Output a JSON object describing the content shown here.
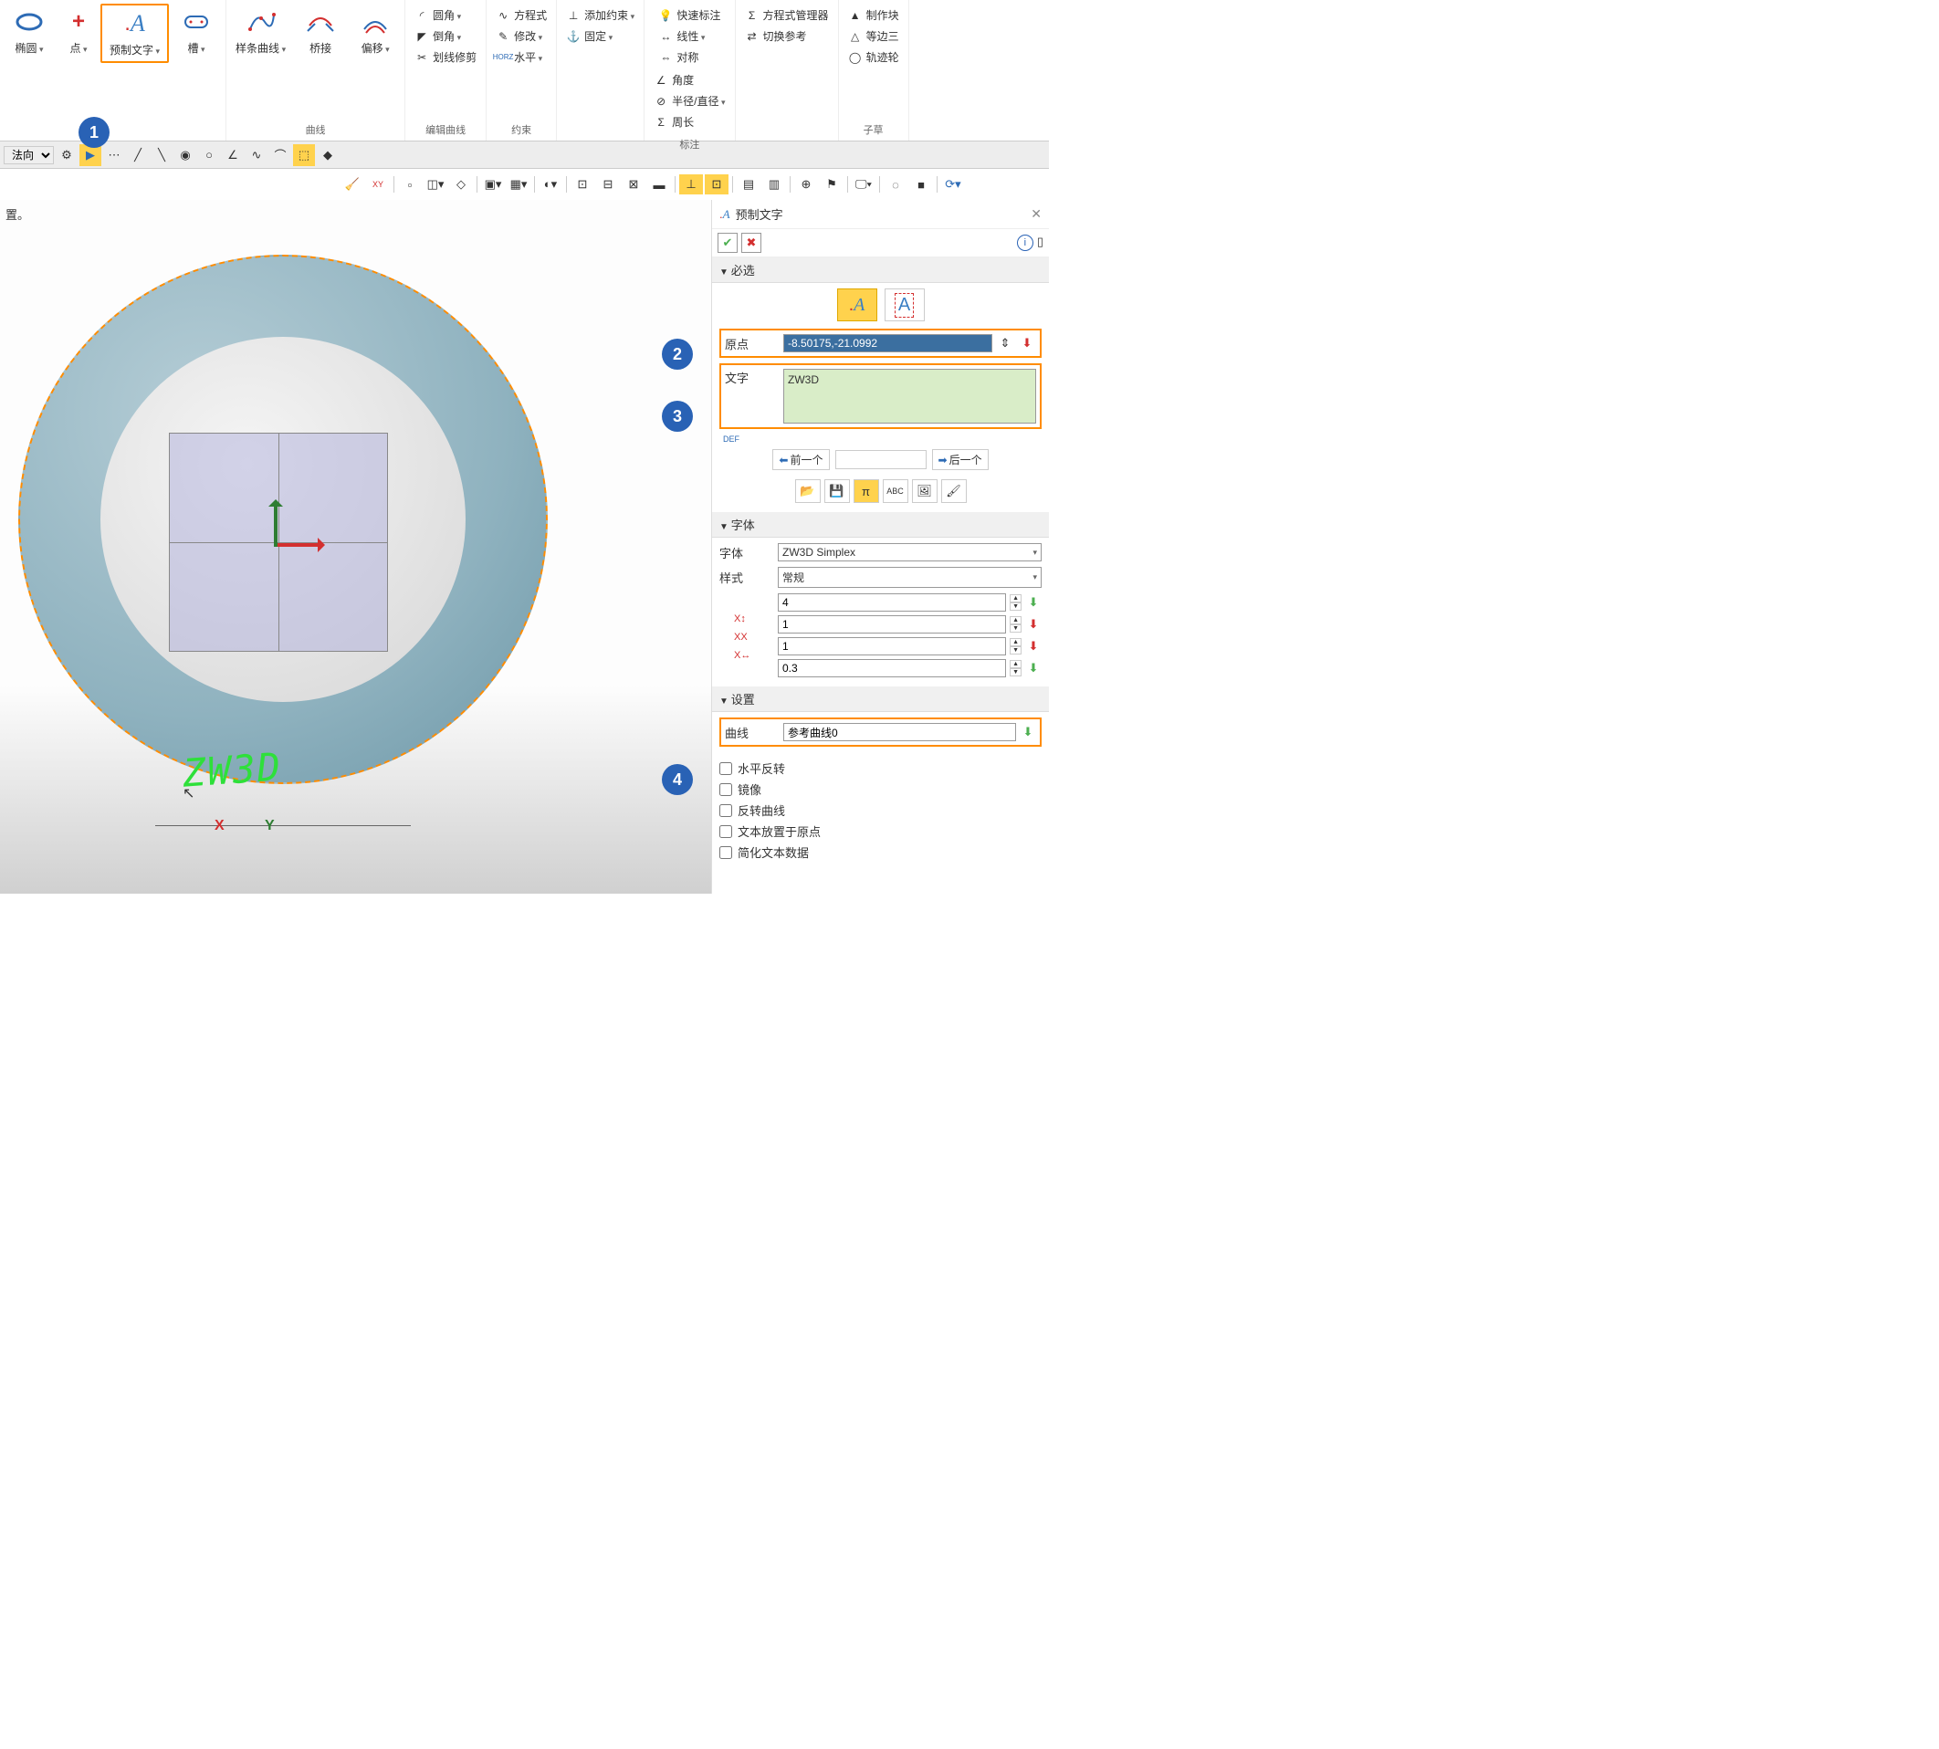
{
  "ribbon": {
    "ellipse": "椭圆",
    "point": "点",
    "readytext": "预制文字",
    "slot": "槽",
    "spline": "样条曲线",
    "bridge": "桥接",
    "offset": "偏移",
    "group_curve": "曲线",
    "fillet": "圆角",
    "chamfer": "倒角",
    "trimline": "划线修剪",
    "group_editcurve": "编辑曲线",
    "equation": "方程式",
    "modify": "修改",
    "horizontal": "水平",
    "group_constraint": "约束",
    "addconstraint": "添加约束",
    "fix": "固定",
    "quickdim": "快速标注",
    "linear": "线性",
    "symmetric": "对称",
    "angle": "角度",
    "radius": "半径/直径",
    "perimeter": "周长",
    "group_dim": "标注",
    "eqmgr": "方程式管理器",
    "switchref": "切换参考",
    "makeblock": "制作块",
    "isotri": "等边三",
    "tracewheel": "轨迹轮",
    "group_subsketch": "子草"
  },
  "quickbar": {
    "normal": "法向"
  },
  "status": "置。",
  "panel": {
    "title": "预制文字",
    "sec_required": "必选",
    "origin_label": "原点",
    "origin_value": "-8.50175,-21.0992",
    "text_label": "文字",
    "text_value": "ZW3D",
    "prev": "前一个",
    "next": "后一个",
    "sec_font": "字体",
    "font_label": "字体",
    "font_value": "ZW3D Simplex",
    "style_label": "样式",
    "style_value": "常规",
    "size1": "4",
    "size2": "1",
    "size3": "1",
    "size4": "0.3",
    "sec_settings": "设置",
    "curve_label": "曲线",
    "curve_value": "参考曲线0",
    "chk_hflip": "水平反转",
    "chk_mirror": "镜像",
    "chk_revcurve": "反转曲线",
    "chk_atorig": "文本放置于原点",
    "chk_simplify": "简化文本数据"
  },
  "viewport": {
    "text3d": "ZW3D"
  },
  "badges": {
    "b1": "1",
    "b2": "2",
    "b3": "3",
    "b4": "4"
  }
}
